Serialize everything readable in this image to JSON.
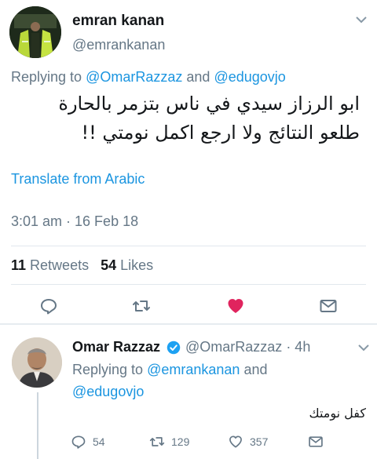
{
  "tweet": {
    "author_name": "emran kanan",
    "author_handle": "@emrankanan",
    "replying_prefix": "Replying to",
    "replying_handle_1": "@OmarRazzaz",
    "replying_and": "and",
    "replying_handle_2": "@edugovjo",
    "text_line_1": "ابو الرزاز سيدي في ناس بتزمر بالحارة",
    "text_line_2": "طلعو النتائج ولا ارجع اكمل نومتي !!",
    "translate_label": "Translate from Arabic",
    "timestamp": "3:01 am · 16 Feb 18",
    "retweets_count": "11",
    "retweets_label": "Retweets",
    "likes_count": "54",
    "likes_label": "Likes",
    "liked": true
  },
  "reply": {
    "author_name": "Omar Razzaz",
    "author_handle": "@OmarRazzaz",
    "time": "· 4h",
    "replying_prefix": "Replying to",
    "replying_handle_1": "@emrankanan",
    "replying_and": "and",
    "replying_handle_2": "@edugovjo",
    "text": "كفل نومتك",
    "reply_count": "54",
    "retweet_count": "129",
    "like_count": "357"
  },
  "colors": {
    "link": "#1b95e0",
    "muted": "#657786",
    "like": "#e0245e"
  }
}
